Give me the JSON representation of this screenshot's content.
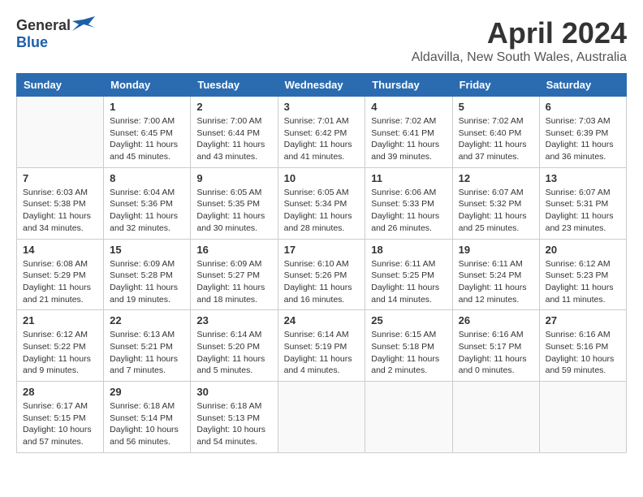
{
  "header": {
    "logo_general": "General",
    "logo_blue": "Blue",
    "month_title": "April 2024",
    "location": "Aldavilla, New South Wales, Australia"
  },
  "days_of_week": [
    "Sunday",
    "Monday",
    "Tuesday",
    "Wednesday",
    "Thursday",
    "Friday",
    "Saturday"
  ],
  "weeks": [
    [
      {
        "day": "",
        "info": ""
      },
      {
        "day": "1",
        "info": "Sunrise: 7:00 AM\nSunset: 6:45 PM\nDaylight: 11 hours\nand 45 minutes."
      },
      {
        "day": "2",
        "info": "Sunrise: 7:00 AM\nSunset: 6:44 PM\nDaylight: 11 hours\nand 43 minutes."
      },
      {
        "day": "3",
        "info": "Sunrise: 7:01 AM\nSunset: 6:42 PM\nDaylight: 11 hours\nand 41 minutes."
      },
      {
        "day": "4",
        "info": "Sunrise: 7:02 AM\nSunset: 6:41 PM\nDaylight: 11 hours\nand 39 minutes."
      },
      {
        "day": "5",
        "info": "Sunrise: 7:02 AM\nSunset: 6:40 PM\nDaylight: 11 hours\nand 37 minutes."
      },
      {
        "day": "6",
        "info": "Sunrise: 7:03 AM\nSunset: 6:39 PM\nDaylight: 11 hours\nand 36 minutes."
      }
    ],
    [
      {
        "day": "7",
        "info": "Sunrise: 6:03 AM\nSunset: 5:38 PM\nDaylight: 11 hours\nand 34 minutes."
      },
      {
        "day": "8",
        "info": "Sunrise: 6:04 AM\nSunset: 5:36 PM\nDaylight: 11 hours\nand 32 minutes."
      },
      {
        "day": "9",
        "info": "Sunrise: 6:05 AM\nSunset: 5:35 PM\nDaylight: 11 hours\nand 30 minutes."
      },
      {
        "day": "10",
        "info": "Sunrise: 6:05 AM\nSunset: 5:34 PM\nDaylight: 11 hours\nand 28 minutes."
      },
      {
        "day": "11",
        "info": "Sunrise: 6:06 AM\nSunset: 5:33 PM\nDaylight: 11 hours\nand 26 minutes."
      },
      {
        "day": "12",
        "info": "Sunrise: 6:07 AM\nSunset: 5:32 PM\nDaylight: 11 hours\nand 25 minutes."
      },
      {
        "day": "13",
        "info": "Sunrise: 6:07 AM\nSunset: 5:31 PM\nDaylight: 11 hours\nand 23 minutes."
      }
    ],
    [
      {
        "day": "14",
        "info": "Sunrise: 6:08 AM\nSunset: 5:29 PM\nDaylight: 11 hours\nand 21 minutes."
      },
      {
        "day": "15",
        "info": "Sunrise: 6:09 AM\nSunset: 5:28 PM\nDaylight: 11 hours\nand 19 minutes."
      },
      {
        "day": "16",
        "info": "Sunrise: 6:09 AM\nSunset: 5:27 PM\nDaylight: 11 hours\nand 18 minutes."
      },
      {
        "day": "17",
        "info": "Sunrise: 6:10 AM\nSunset: 5:26 PM\nDaylight: 11 hours\nand 16 minutes."
      },
      {
        "day": "18",
        "info": "Sunrise: 6:11 AM\nSunset: 5:25 PM\nDaylight: 11 hours\nand 14 minutes."
      },
      {
        "day": "19",
        "info": "Sunrise: 6:11 AM\nSunset: 5:24 PM\nDaylight: 11 hours\nand 12 minutes."
      },
      {
        "day": "20",
        "info": "Sunrise: 6:12 AM\nSunset: 5:23 PM\nDaylight: 11 hours\nand 11 minutes."
      }
    ],
    [
      {
        "day": "21",
        "info": "Sunrise: 6:12 AM\nSunset: 5:22 PM\nDaylight: 11 hours\nand 9 minutes."
      },
      {
        "day": "22",
        "info": "Sunrise: 6:13 AM\nSunset: 5:21 PM\nDaylight: 11 hours\nand 7 minutes."
      },
      {
        "day": "23",
        "info": "Sunrise: 6:14 AM\nSunset: 5:20 PM\nDaylight: 11 hours\nand 5 minutes."
      },
      {
        "day": "24",
        "info": "Sunrise: 6:14 AM\nSunset: 5:19 PM\nDaylight: 11 hours\nand 4 minutes."
      },
      {
        "day": "25",
        "info": "Sunrise: 6:15 AM\nSunset: 5:18 PM\nDaylight: 11 hours\nand 2 minutes."
      },
      {
        "day": "26",
        "info": "Sunrise: 6:16 AM\nSunset: 5:17 PM\nDaylight: 11 hours\nand 0 minutes."
      },
      {
        "day": "27",
        "info": "Sunrise: 6:16 AM\nSunset: 5:16 PM\nDaylight: 10 hours\nand 59 minutes."
      }
    ],
    [
      {
        "day": "28",
        "info": "Sunrise: 6:17 AM\nSunset: 5:15 PM\nDaylight: 10 hours\nand 57 minutes."
      },
      {
        "day": "29",
        "info": "Sunrise: 6:18 AM\nSunset: 5:14 PM\nDaylight: 10 hours\nand 56 minutes."
      },
      {
        "day": "30",
        "info": "Sunrise: 6:18 AM\nSunset: 5:13 PM\nDaylight: 10 hours\nand 54 minutes."
      },
      {
        "day": "",
        "info": ""
      },
      {
        "day": "",
        "info": ""
      },
      {
        "day": "",
        "info": ""
      },
      {
        "day": "",
        "info": ""
      }
    ]
  ]
}
